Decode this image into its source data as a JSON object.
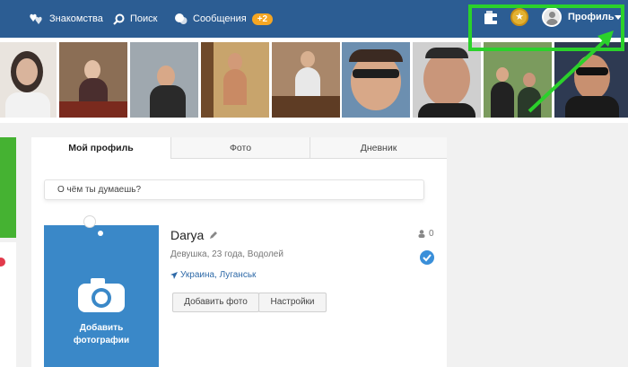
{
  "nav": {
    "dating_label": "Знакомства",
    "search_label": "Поиск",
    "messages_label": "Сообщения",
    "messages_badge": "+2",
    "profile_label": "Профиль"
  },
  "photo_strip": {
    "count": 9
  },
  "tabs": {
    "my_profile": "Мой профиль",
    "photo": "Фото",
    "diary": "Дневник"
  },
  "status": {
    "placeholder": "О чём ты думаешь?"
  },
  "profile": {
    "name": "Darya",
    "details": "Девушка, 23 года, Водолей",
    "location": "Украина, Луганськ",
    "friends_count": "0",
    "add_photo_caption_line1": "Добавить",
    "add_photo_caption_line2": "фотографии",
    "add_photo_button": "Добавить фото",
    "settings_button": "Настройки"
  },
  "colors": {
    "topbar": "#2c5d93",
    "highlight": "#2bd12b",
    "badge": "#f5a623",
    "photo_box": "#3a88c8"
  }
}
